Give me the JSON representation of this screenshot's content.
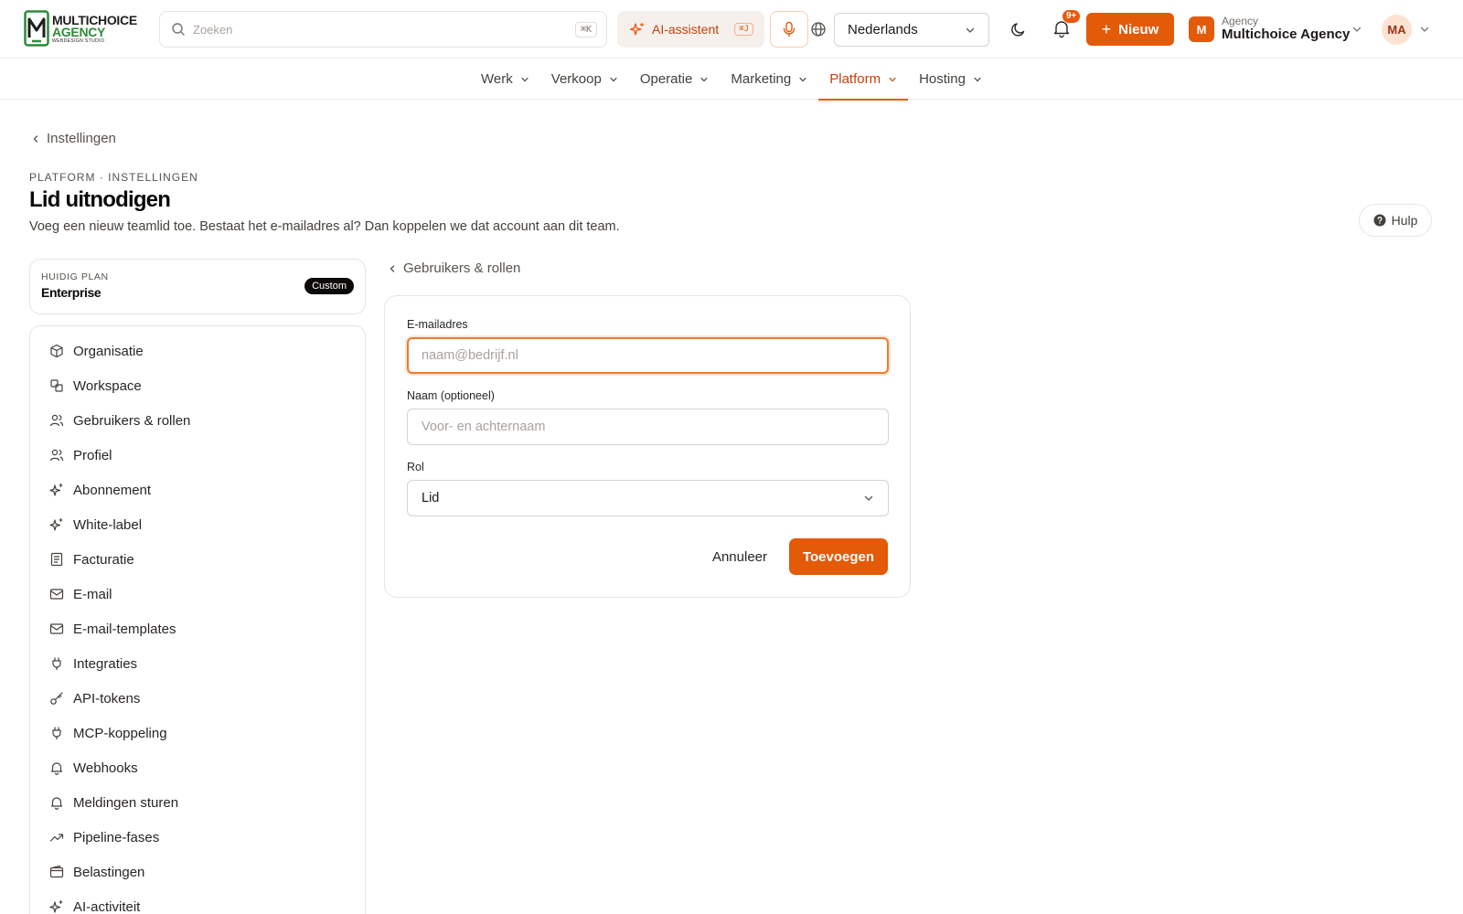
{
  "brand": {
    "line1": "MULTICHOICE",
    "line2": "AGENCY",
    "line3": "WEBDESIGN STUDIO"
  },
  "search": {
    "placeholder": "Zoeken",
    "shortcut": "⌘K",
    "icon": "search-icon"
  },
  "ai_assistant": {
    "label": "AI-assistent",
    "shortcut": "⌘J",
    "icon": "sparkle-icon"
  },
  "language": {
    "selected": "Nederlands"
  },
  "notifications": {
    "badge": "9+"
  },
  "new_button": {
    "label": "Nieuw"
  },
  "agency": {
    "avatar_letter": "M",
    "label": "Agency",
    "name": "Multichoice Agency"
  },
  "user": {
    "initials": "MA"
  },
  "nav": {
    "items": [
      {
        "label": "Werk"
      },
      {
        "label": "Verkoop"
      },
      {
        "label": "Operatie"
      },
      {
        "label": "Marketing"
      },
      {
        "label": "Platform"
      },
      {
        "label": "Hosting"
      }
    ],
    "active": "Platform"
  },
  "page": {
    "back_label": "Instellingen",
    "eyebrow": "PLATFORM · INSTELLINGEN",
    "title": "Lid uitnodigen",
    "subtitle": "Voeg een nieuw teamlid toe. Bestaat het e-mailadres al? Dan koppelen we dat account aan dit team.",
    "help_label": "Hulp"
  },
  "plan": {
    "label": "HUIDIG PLAN",
    "name": "Enterprise",
    "badge": "Custom"
  },
  "sidebar": {
    "items": [
      {
        "label": "Organisatie",
        "icon": "cube-icon"
      },
      {
        "label": "Workspace",
        "icon": "workspace-icon"
      },
      {
        "label": "Gebruikers & rollen",
        "icon": "users-icon"
      },
      {
        "label": "Profiel",
        "icon": "users-icon"
      },
      {
        "label": "Abonnement",
        "icon": "sparkle-icon"
      },
      {
        "label": "White-label",
        "icon": "sparkle-icon"
      },
      {
        "label": "Facturatie",
        "icon": "receipt-icon"
      },
      {
        "label": "E-mail",
        "icon": "mail-icon"
      },
      {
        "label": "E-mail-templates",
        "icon": "mail-icon"
      },
      {
        "label": "Integraties",
        "icon": "plug-icon"
      },
      {
        "label": "API-tokens",
        "icon": "key-icon"
      },
      {
        "label": "MCP-koppeling",
        "icon": "plug-icon"
      },
      {
        "label": "Webhooks",
        "icon": "bell-icon"
      },
      {
        "label": "Meldingen sturen",
        "icon": "bell-icon"
      },
      {
        "label": "Pipeline-fases",
        "icon": "trend-icon"
      },
      {
        "label": "Belastingen",
        "icon": "wallet-icon"
      },
      {
        "label": "AI-activiteit",
        "icon": "sparkle-icon"
      }
    ]
  },
  "form": {
    "section_back": "Gebruikers & rollen",
    "email": {
      "label": "E-mailadres",
      "placeholder": "naam@bedrijf.nl",
      "value": ""
    },
    "name": {
      "label": "Naam (optioneel)",
      "placeholder": "Voor- en achternaam",
      "value": ""
    },
    "role": {
      "label": "Rol",
      "selected": "Lid"
    },
    "cancel_label": "Annuleer",
    "submit_label": "Toevoegen"
  },
  "colors": {
    "accent": "#e35a09",
    "brand_green": "#2c8a3a",
    "text": "#1c1917"
  }
}
